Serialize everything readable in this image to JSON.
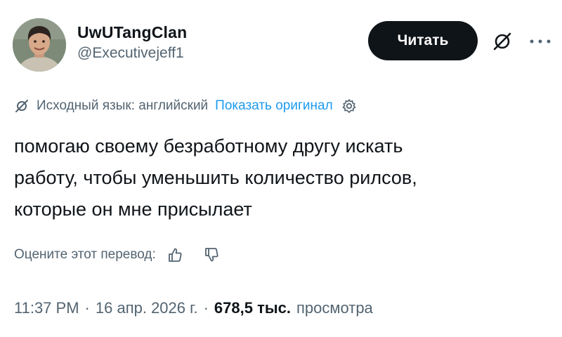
{
  "author": {
    "display_name": "UwUTangClan",
    "handle": "@Executivejeff1",
    "avatar_icon": "profile-photo"
  },
  "actions": {
    "follow_label": "Читать",
    "grok_icon": "grok-icon",
    "more_icon": "more-icon"
  },
  "translation": {
    "source_language_text": "Исходный язык: английский",
    "show_original_label": "Показать оригинал",
    "translate_icon": "grok-icon",
    "settings_icon": "gear-icon"
  },
  "tweet": {
    "text": "помогаю своему безработному другу искать\nработу, чтобы уменьшить количество рилсов,\nкоторые он мне присылает"
  },
  "rating": {
    "label": "Оцените этот перевод:",
    "like_icon": "thumb-up-icon",
    "dislike_icon": "thumb-down-icon"
  },
  "meta": {
    "time": "11:37 PM",
    "separator": "·",
    "date": "16 апр. 2026 г.",
    "views_count": "678,5 тыс.",
    "views_label": "просмотра"
  },
  "colors": {
    "text_primary": "#0f1419",
    "text_secondary": "#536471",
    "link": "#1d9bf0",
    "button_bg": "#0f1419"
  }
}
